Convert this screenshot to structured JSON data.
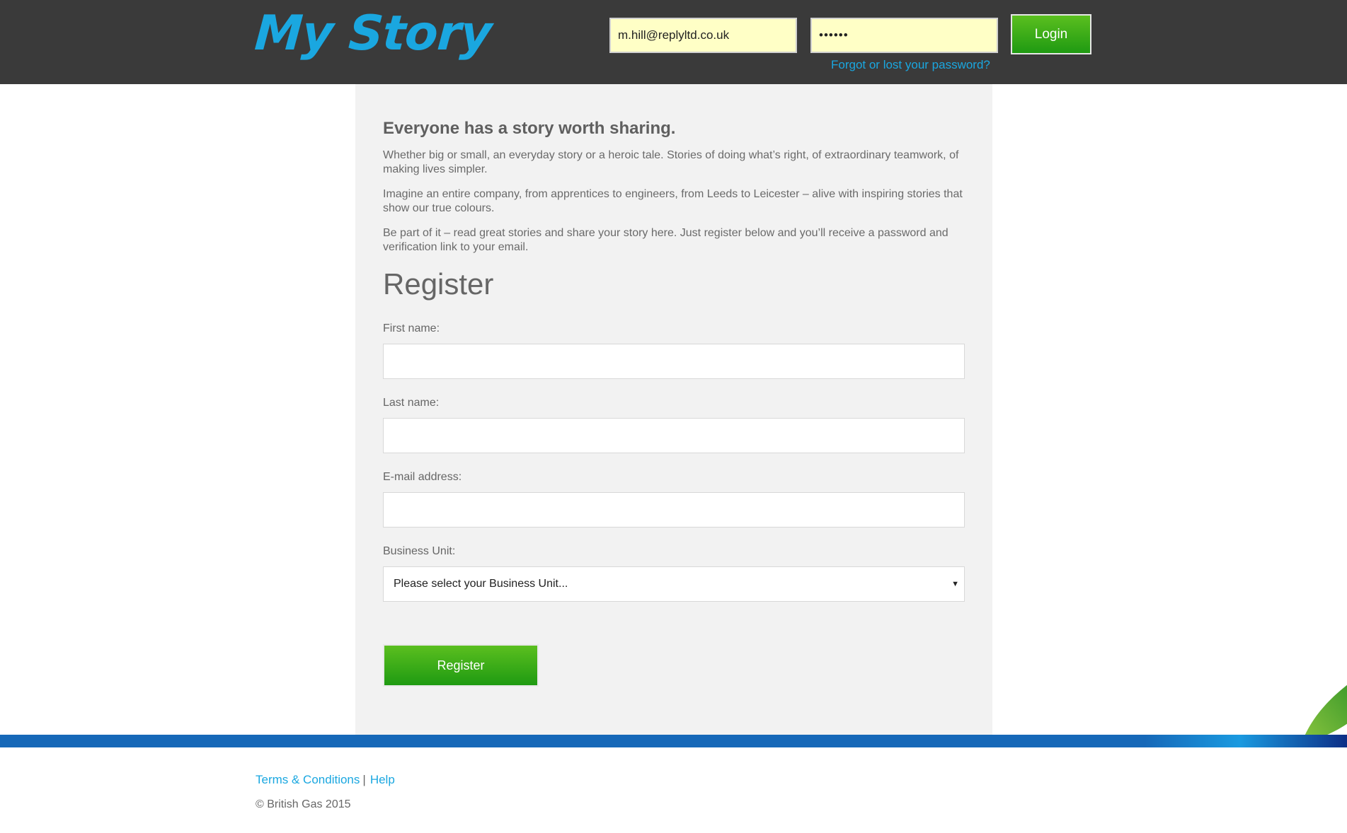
{
  "header": {
    "logo": "My Story",
    "email_value": "m.hill@replyltd.co.uk",
    "password_value": "••••••",
    "login_label": "Login",
    "forgot_link": "Forgot or lost your password?"
  },
  "intro": {
    "tagline": "Everyone has a story worth sharing.",
    "paragraphs": [
      "Whether big or small, an everyday story or a heroic tale. Stories of doing what’s right, of extraordinary teamwork, of making lives simpler.",
      "Imagine an entire company, from apprentices to engineers, from Leeds to Leicester – alive with inspiring stories that show our true colours.",
      "Be part of it – read great stories and share your story here. Just register below and you’ll receive a password and verification link to your email."
    ]
  },
  "form": {
    "title": "Register",
    "first_name_label": "First name:",
    "last_name_label": "Last name:",
    "email_label": "E-mail address:",
    "business_unit_label": "Business Unit:",
    "business_unit_selected": "Please select your Business Unit...",
    "submit_label": "Register"
  },
  "footer": {
    "terms": "Terms & Conditions",
    "separator": "|",
    "help": "Help",
    "copyright": "© British Gas 2015"
  },
  "colors": {
    "header_bg": "#3a3a3a",
    "accent_blue": "#1aa7e0",
    "button_green": "#2fa516",
    "panel_bg": "#f2f2f2",
    "input_yellow": "#ffffc6"
  },
  "icons": {
    "select_caret": "caret-down-icon",
    "brand_swoosh": "leaf-swoosh-icon"
  }
}
